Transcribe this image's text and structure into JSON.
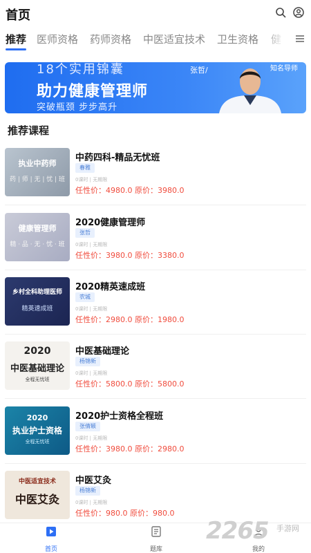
{
  "header": {
    "title": "首页"
  },
  "tabs": [
    {
      "label": "推荐"
    },
    {
      "label": "医师资格"
    },
    {
      "label": "药师资格"
    },
    {
      "label": "中医适宜技术"
    },
    {
      "label": "卫生资格"
    },
    {
      "label": "健"
    }
  ],
  "banner": {
    "line1": "18个实用锦囊",
    "line2": "助力健康管理师",
    "line3": "突破瓶颈 步步高升",
    "teacher": "张哲/",
    "teacher_title": "知名导师"
  },
  "section_title": "推荐课程",
  "courses": [
    {
      "name": "中药四科-精品无忧班",
      "tag": "春雅",
      "meta": "0课时 | 无期限",
      "price": "任性价：4980.0  原价：3980.0",
      "thumb_line1": "执业中药师",
      "thumb_line2": "药 | 师 | 无 | 忧 | 班"
    },
    {
      "name": "2020健康管理师",
      "tag": "张哲",
      "meta": "0课时 | 无期限",
      "price": "任性价：3980.0  原价：3380.0",
      "thumb_line1": "健康管理师",
      "thumb_line2": "精 · 品 · 无 · 忧 · 班"
    },
    {
      "name": "2020精英速成班",
      "tag": "农城",
      "meta": "0课时 | 无期限",
      "price": "任性价：2980.0  原价：1980.0",
      "thumb_line1": "乡村全科助理医师",
      "thumb_line2": "精英速成班"
    },
    {
      "name": "中医基础理论",
      "tag": "杨锦新",
      "meta": "0课时 | 无期限",
      "price": "任性价：5800.0  原价：5800.0",
      "thumb_line1": "2020",
      "thumb_line2": "中医基础理论",
      "thumb_line3": "全程无忧班"
    },
    {
      "name": "2020护士资格全程班",
      "tag": "张倩颖",
      "meta": "0课时 | 无期限",
      "price": "任性价：3980.0  原价：2980.0",
      "thumb_line1": "2020",
      "thumb_line2": "执业护士资格",
      "thumb_line3": "全程无忧班"
    },
    {
      "name": "中医艾灸",
      "tag": "杨锦新",
      "meta": "0课时 | 无期限",
      "price": "任性价：980.0  原价：980.0",
      "thumb_line1": "中医适宜技术",
      "thumb_line2": "中医艾灸"
    }
  ],
  "bottom_nav": [
    {
      "label": "首页",
      "icon": "home-icon"
    },
    {
      "label": "题库",
      "icon": "question-bank-icon"
    },
    {
      "label": "我的",
      "icon": "profile-icon"
    }
  ],
  "watermark": {
    "main": "2265",
    "sub": "手游网"
  },
  "colors": {
    "accent": "#2d6ff5",
    "price": "#f04b3c",
    "tag_bg": "#e8f0fd"
  }
}
